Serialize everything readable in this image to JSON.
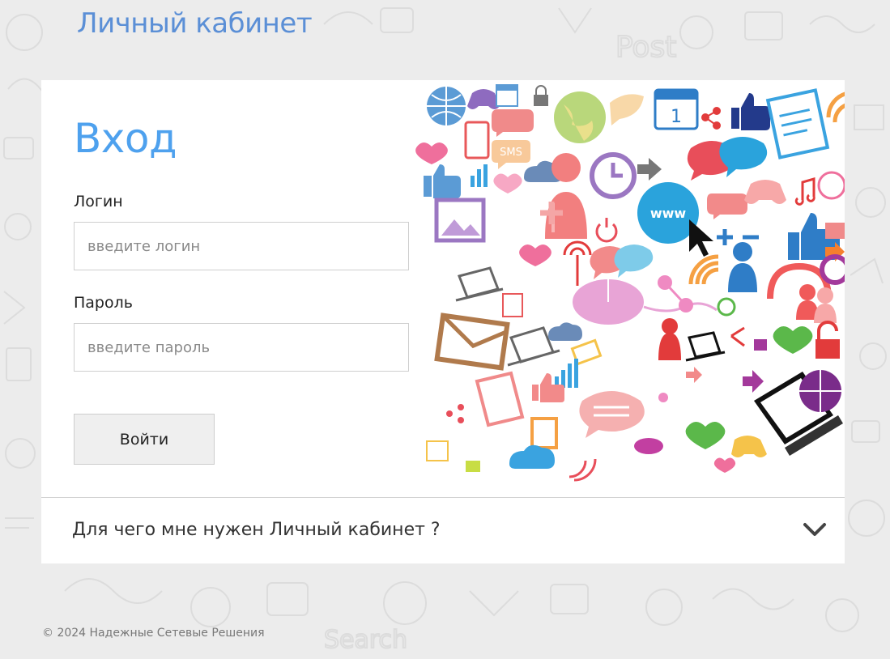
{
  "header": {
    "title": "Личный кабинет"
  },
  "login": {
    "title": "Вход",
    "username_label": "Логин",
    "username_placeholder": "введите логин",
    "password_label": "Пароль",
    "password_placeholder": "введите пароль",
    "submit_label": "Войти"
  },
  "faq": {
    "question": "Для чего мне нужен Личный кабинет ?",
    "icon": "chevron-down-icon"
  },
  "illustration": {
    "badge_www": "www",
    "badge_sms": "SMS",
    "calendar_day": "1"
  },
  "footer": {
    "copyright": "© 2024 Надежные Сетевые Решения"
  },
  "colors": {
    "header_title": "#5b8fd6",
    "login_title": "#4ea1ee",
    "background": "#ececec",
    "card": "#ffffff"
  }
}
